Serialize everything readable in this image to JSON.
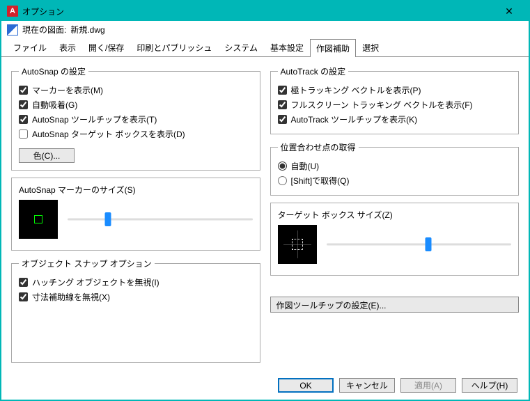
{
  "window": {
    "title": "オプション"
  },
  "toolbar": {
    "label": "現在の図面:",
    "filename": "新規.dwg"
  },
  "tabs": {
    "items": [
      {
        "label": "ファイル"
      },
      {
        "label": "表示"
      },
      {
        "label": "開く/保存"
      },
      {
        "label": "印刷とパブリッシュ"
      },
      {
        "label": "システム"
      },
      {
        "label": "基本設定"
      },
      {
        "label": "作図補助"
      },
      {
        "label": "選択"
      }
    ],
    "active_index": 6
  },
  "autosnap": {
    "legend": "AutoSnap の設定",
    "marker": "マーカーを表示(M)",
    "magnet": "自動吸着(G)",
    "tooltip": "AutoSnap ツールチップを表示(T)",
    "aperture": "AutoSnap ターゲット ボックスを表示(D)",
    "color_btn": "色(C)..."
  },
  "marker_size": {
    "label": "AutoSnap マーカーのサイズ(S)",
    "value_pct": 22
  },
  "osnap_opt": {
    "legend": "オブジェクト スナップ オプション",
    "hatch": "ハッチング オブジェクトを無視(I)",
    "ext": "寸法補助線を無視(X)"
  },
  "autotrack": {
    "legend": "AutoTrack の設定",
    "polar": "極トラッキング ベクトルを表示(P)",
    "fullscreen": "フルスクリーン トラッキング ベクトルを表示(F)",
    "tooltip": "AutoTrack ツールチップを表示(K)"
  },
  "align": {
    "legend": "位置合わせ点の取得",
    "auto": "自動(U)",
    "shift": "[Shift]で取得(Q)"
  },
  "target_size": {
    "label": "ターゲット ボックス サイズ(Z)",
    "value_pct": 55
  },
  "tooltip_btn": "作図ツールチップの設定(E)...",
  "footer": {
    "ok": "OK",
    "cancel": "キャンセル",
    "apply": "適用(A)",
    "help": "ヘルプ(H)"
  }
}
